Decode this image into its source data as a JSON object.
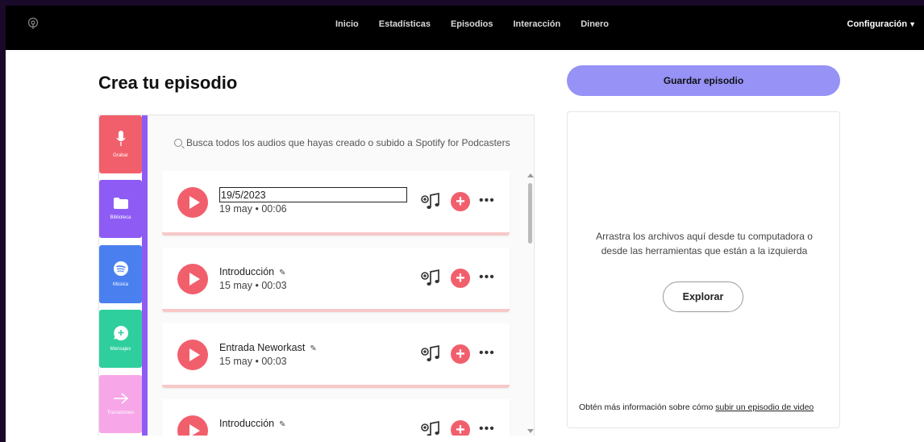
{
  "nav": {
    "items": [
      "Inicio",
      "Estadísticas",
      "Episodios",
      "Interacción",
      "Dinero"
    ],
    "config_label": "Configuración"
  },
  "page": {
    "title": "Crea tu episodio"
  },
  "tools": [
    {
      "label": "Grabar",
      "icon": "microphone-icon",
      "color": "#f25f6c"
    },
    {
      "label": "Biblioteca",
      "icon": "folder-icon",
      "color": "#8e5cf5"
    },
    {
      "label": "Música",
      "icon": "spotify-icon",
      "color": "#4a7ff0"
    },
    {
      "label": "Mensajes",
      "icon": "message-icon",
      "color": "#2fcf9d"
    },
    {
      "label": "Transiciones",
      "icon": "arrow-right-icon",
      "color": "#f7a6e8"
    }
  ],
  "search": {
    "placeholder": "Busca todos los audios que hayas creado o subido a Spotify for Podcasters"
  },
  "episodes": [
    {
      "name": "19/5/2023",
      "meta": "19 may • 00:06",
      "editing": true
    },
    {
      "name": "Introducción",
      "meta": "15 may • 00:03",
      "editing": false
    },
    {
      "name": "Entrada Neworkast",
      "meta": "15 may • 00:03",
      "editing": false
    },
    {
      "name": "Introducción",
      "meta": "",
      "editing": false
    }
  ],
  "right": {
    "save_label": "Guardar episodio",
    "drop_text": "Arrastra los archivos aquí desde tu computadora o desde las herramientas que están a la izquierda",
    "explore_label": "Explorar",
    "footer_text": "Obtén más información sobre cómo ",
    "footer_link": "subir un episodio de video"
  },
  "colors": {
    "accent": "#9692f6",
    "record": "#f25f6c",
    "library": "#8e5cf5"
  }
}
